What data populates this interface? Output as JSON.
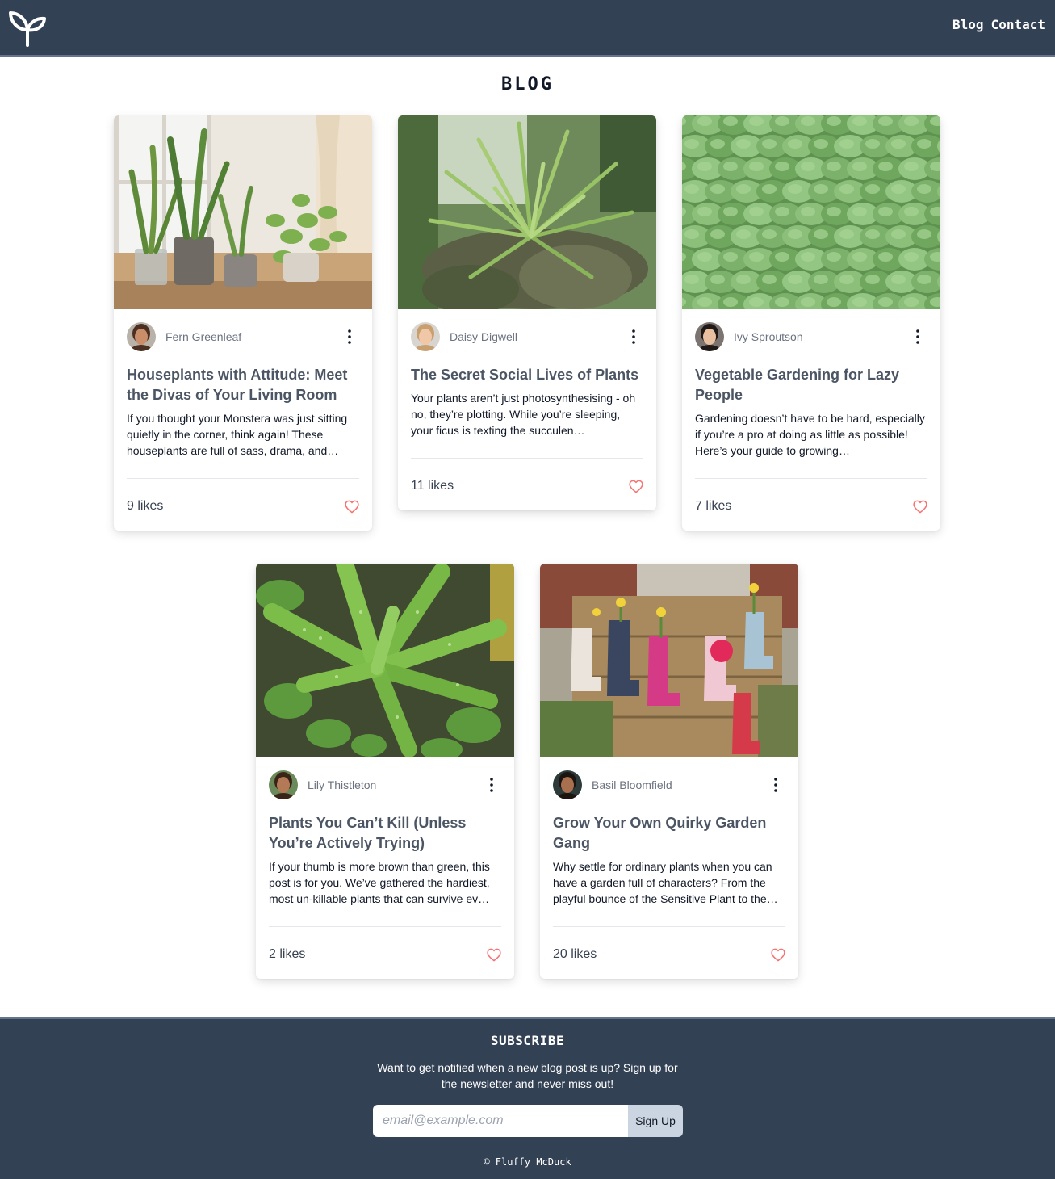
{
  "header": {
    "logo_icon": "sprout-icon",
    "nav": [
      {
        "label": "Blog"
      },
      {
        "label": "Contact"
      }
    ]
  },
  "page": {
    "title": "BLOG"
  },
  "posts": [
    {
      "image": "houseplants-windowsill-photo",
      "author": "Fern Greenleaf",
      "title": "Houseplants with Attitude: Meet the Divas of Your Living Room",
      "excerpt": "If you thought your Monstera was just sitting quietly in the corner, think again! These houseplants are full of sass, drama, and…",
      "likes": "9 likes"
    },
    {
      "image": "tropical-greenhouse-plant-photo",
      "author": "Daisy Digwell",
      "title": "The Secret Social Lives of Plants",
      "excerpt": "Your plants aren’t just photosynthesising - oh no, they’re plotting. While you’re sleeping, your ficus is texting the succulen…",
      "likes": "11 likes"
    },
    {
      "image": "lettuce-field-photo",
      "author": "Ivy Sproutson",
      "title": "Vegetable Gardening for Lazy People",
      "excerpt": "Gardening doesn’t have to be hard, especially if you’re a pro at doing as little as possible! Here’s your guide to growing…",
      "likes": "7 likes"
    },
    {
      "image": "aloe-vera-photo",
      "author": "Lily Thistleton",
      "title": "Plants You Can’t Kill (Unless You’re Actively Trying)",
      "excerpt": "If your thumb is more brown than green, this post is for you. We’ve gathered the hardiest, most un-killable plants that can survive ev…",
      "likes": "2 likes"
    },
    {
      "image": "welly-boot-planters-photo",
      "author": "Basil Bloomfield",
      "title": "Grow Your Own Quirky Garden Gang",
      "excerpt": "Why settle for ordinary plants when you can have a garden full of characters? From the playful bounce of the Sensitive Plant to the…",
      "likes": "20 likes"
    }
  ],
  "footer": {
    "subscribe_title": "SUBSCRIBE",
    "subscribe_text": "Want to get notified when a new blog post is up? Sign up for the newsletter and never miss out!",
    "email_placeholder": "email@example.com",
    "signup_label": "Sign Up",
    "copyright": "© Fluffy McDuck"
  },
  "colors": {
    "header_bg": "#334155",
    "heart": "#f87171",
    "signup_bg": "#cbd5e1"
  }
}
